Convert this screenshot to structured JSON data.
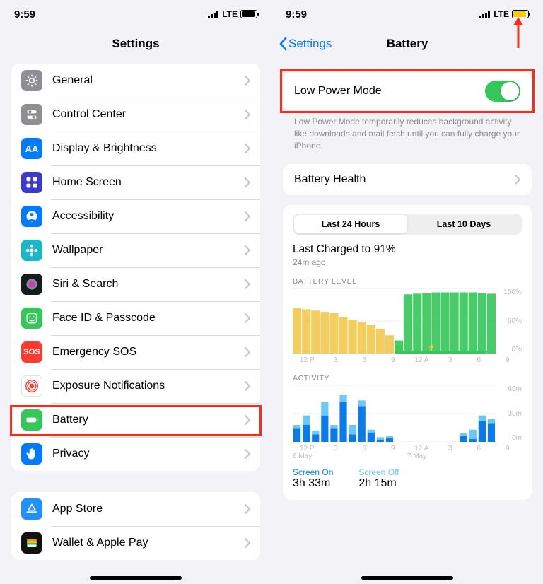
{
  "left": {
    "status": {
      "time": "9:59",
      "carrier": "LTE"
    },
    "header": {
      "title": "Settings"
    },
    "group1": [
      {
        "label": "General",
        "icon_bg": "#8e8e93",
        "icon": "gear"
      },
      {
        "label": "Control Center",
        "icon_bg": "#8e8e93",
        "icon": "sliders"
      },
      {
        "label": "Display & Brightness",
        "icon_bg": "#007aff",
        "icon": "aa"
      },
      {
        "label": "Home Screen",
        "icon_bg": "#3a3acb",
        "icon": "grid"
      },
      {
        "label": "Accessibility",
        "icon_bg": "#007aff",
        "icon": "person"
      },
      {
        "label": "Wallpaper",
        "icon_bg": "#19b8c9",
        "icon": "flower"
      },
      {
        "label": "Siri & Search",
        "icon_bg": "#1a1a1a",
        "icon": "siri"
      },
      {
        "label": "Face ID & Passcode",
        "icon_bg": "#34c759",
        "icon": "face"
      },
      {
        "label": "Emergency SOS",
        "icon_bg": "#ff3b30",
        "icon": "sos"
      },
      {
        "label": "Exposure Notifications",
        "icon_bg": "#ffffff",
        "icon": "exposure"
      },
      {
        "label": "Battery",
        "icon_bg": "#34c759",
        "icon": "battery"
      },
      {
        "label": "Privacy",
        "icon_bg": "#007aff",
        "icon": "hand"
      }
    ],
    "group2": [
      {
        "label": "App Store",
        "icon_bg": "#1e90ff",
        "icon": "appstore"
      },
      {
        "label": "Wallet & Apple Pay",
        "icon_bg": "#111111",
        "icon": "wallet"
      }
    ]
  },
  "right": {
    "status": {
      "time": "9:59",
      "carrier": "LTE"
    },
    "nav": {
      "back": "Settings",
      "title": "Battery"
    },
    "lpm": {
      "label": "Low Power Mode",
      "on": true
    },
    "lpm_hint": "Low Power Mode temporarily reduces background activity like downloads and mail fetch until you can fully charge your iPhone.",
    "health": {
      "label": "Battery Health"
    },
    "segmented": {
      "options": [
        "Last 24 Hours",
        "Last 10 Days"
      ],
      "active": 0
    },
    "charged": {
      "title": "Last Charged to 91%",
      "sub": "24m ago"
    },
    "level_chart": {
      "heading": "BATTERY LEVEL",
      "yticks": [
        "100%",
        "50%",
        "0%"
      ],
      "xticks": [
        "12 P",
        "3",
        "6",
        "9",
        "12 A",
        "3",
        "6",
        "9"
      ]
    },
    "activity_chart": {
      "heading": "ACTIVITY",
      "yticks": [
        "60m",
        "30m",
        "0m"
      ],
      "xticks": [
        "12 P",
        "3",
        "6",
        "9",
        "12 A",
        "3",
        "6",
        "9"
      ],
      "xsub": [
        "6 May",
        "7 May"
      ]
    },
    "legend": {
      "on": {
        "label": "Screen On",
        "value": "3h 33m"
      },
      "off": {
        "label": "Screen Off",
        "value": "2h 15m"
      }
    }
  },
  "chart_data": [
    {
      "type": "area",
      "title": "BATTERY LEVEL",
      "ylim": [
        0,
        100
      ],
      "x": [
        "12P",
        "1",
        "2",
        "3",
        "4",
        "5",
        "6",
        "7",
        "8",
        "9",
        "10",
        "11",
        "12A",
        "1",
        "2",
        "3",
        "4",
        "5",
        "6",
        "7",
        "8",
        "9"
      ],
      "series": [
        {
          "name": "discharge-yellow",
          "color": "#f2c94c",
          "values": [
            70,
            68,
            66,
            64,
            62,
            56,
            52,
            48,
            44,
            38,
            28,
            12,
            null,
            null,
            null,
            null,
            null,
            null,
            null,
            null,
            null,
            null
          ]
        },
        {
          "name": "charged-green",
          "color": "#34c759",
          "values": [
            null,
            null,
            null,
            null,
            null,
            null,
            null,
            null,
            null,
            null,
            null,
            20,
            91,
            92,
            93,
            94,
            94,
            94,
            94,
            94,
            93,
            92
          ]
        }
      ]
    },
    {
      "type": "bar",
      "title": "ACTIVITY",
      "ylabel": "minutes",
      "ylim": [
        0,
        60
      ],
      "categories": [
        "12P",
        "1",
        "2",
        "3",
        "4",
        "5",
        "6",
        "7",
        "8",
        "9",
        "10",
        "11",
        "12A",
        "1",
        "2",
        "3",
        "4",
        "5",
        "6",
        "7",
        "8",
        "9"
      ],
      "series": [
        {
          "name": "Screen On",
          "color": "#0a7bea",
          "values": [
            14,
            18,
            8,
            28,
            14,
            42,
            8,
            38,
            10,
            2,
            4,
            0,
            0,
            0,
            0,
            0,
            0,
            0,
            6,
            3,
            22,
            20
          ]
        },
        {
          "name": "Screen Off",
          "color": "#6ac8ff",
          "values": [
            4,
            10,
            4,
            14,
            4,
            8,
            10,
            6,
            3,
            3,
            2,
            0,
            0,
            0,
            0,
            0,
            0,
            0,
            3,
            10,
            6,
            4
          ]
        }
      ]
    }
  ]
}
